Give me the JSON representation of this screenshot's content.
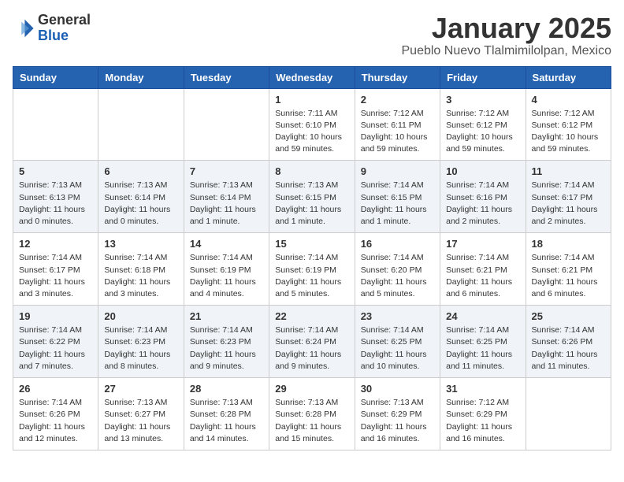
{
  "header": {
    "logo_general": "General",
    "logo_blue": "Blue",
    "month_title": "January 2025",
    "location": "Pueblo Nuevo Tlalmimilolpan, Mexico"
  },
  "days_of_week": [
    "Sunday",
    "Monday",
    "Tuesday",
    "Wednesday",
    "Thursday",
    "Friday",
    "Saturday"
  ],
  "weeks": [
    [
      {
        "day": "",
        "info": ""
      },
      {
        "day": "",
        "info": ""
      },
      {
        "day": "",
        "info": ""
      },
      {
        "day": "1",
        "info": "Sunrise: 7:11 AM\nSunset: 6:10 PM\nDaylight: 10 hours\nand 59 minutes."
      },
      {
        "day": "2",
        "info": "Sunrise: 7:12 AM\nSunset: 6:11 PM\nDaylight: 10 hours\nand 59 minutes."
      },
      {
        "day": "3",
        "info": "Sunrise: 7:12 AM\nSunset: 6:12 PM\nDaylight: 10 hours\nand 59 minutes."
      },
      {
        "day": "4",
        "info": "Sunrise: 7:12 AM\nSunset: 6:12 PM\nDaylight: 10 hours\nand 59 minutes."
      }
    ],
    [
      {
        "day": "5",
        "info": "Sunrise: 7:13 AM\nSunset: 6:13 PM\nDaylight: 11 hours\nand 0 minutes."
      },
      {
        "day": "6",
        "info": "Sunrise: 7:13 AM\nSunset: 6:14 PM\nDaylight: 11 hours\nand 0 minutes."
      },
      {
        "day": "7",
        "info": "Sunrise: 7:13 AM\nSunset: 6:14 PM\nDaylight: 11 hours\nand 1 minute."
      },
      {
        "day": "8",
        "info": "Sunrise: 7:13 AM\nSunset: 6:15 PM\nDaylight: 11 hours\nand 1 minute."
      },
      {
        "day": "9",
        "info": "Sunrise: 7:14 AM\nSunset: 6:15 PM\nDaylight: 11 hours\nand 1 minute."
      },
      {
        "day": "10",
        "info": "Sunrise: 7:14 AM\nSunset: 6:16 PM\nDaylight: 11 hours\nand 2 minutes."
      },
      {
        "day": "11",
        "info": "Sunrise: 7:14 AM\nSunset: 6:17 PM\nDaylight: 11 hours\nand 2 minutes."
      }
    ],
    [
      {
        "day": "12",
        "info": "Sunrise: 7:14 AM\nSunset: 6:17 PM\nDaylight: 11 hours\nand 3 minutes."
      },
      {
        "day": "13",
        "info": "Sunrise: 7:14 AM\nSunset: 6:18 PM\nDaylight: 11 hours\nand 3 minutes."
      },
      {
        "day": "14",
        "info": "Sunrise: 7:14 AM\nSunset: 6:19 PM\nDaylight: 11 hours\nand 4 minutes."
      },
      {
        "day": "15",
        "info": "Sunrise: 7:14 AM\nSunset: 6:19 PM\nDaylight: 11 hours\nand 5 minutes."
      },
      {
        "day": "16",
        "info": "Sunrise: 7:14 AM\nSunset: 6:20 PM\nDaylight: 11 hours\nand 5 minutes."
      },
      {
        "day": "17",
        "info": "Sunrise: 7:14 AM\nSunset: 6:21 PM\nDaylight: 11 hours\nand 6 minutes."
      },
      {
        "day": "18",
        "info": "Sunrise: 7:14 AM\nSunset: 6:21 PM\nDaylight: 11 hours\nand 6 minutes."
      }
    ],
    [
      {
        "day": "19",
        "info": "Sunrise: 7:14 AM\nSunset: 6:22 PM\nDaylight: 11 hours\nand 7 minutes."
      },
      {
        "day": "20",
        "info": "Sunrise: 7:14 AM\nSunset: 6:23 PM\nDaylight: 11 hours\nand 8 minutes."
      },
      {
        "day": "21",
        "info": "Sunrise: 7:14 AM\nSunset: 6:23 PM\nDaylight: 11 hours\nand 9 minutes."
      },
      {
        "day": "22",
        "info": "Sunrise: 7:14 AM\nSunset: 6:24 PM\nDaylight: 11 hours\nand 9 minutes."
      },
      {
        "day": "23",
        "info": "Sunrise: 7:14 AM\nSunset: 6:25 PM\nDaylight: 11 hours\nand 10 minutes."
      },
      {
        "day": "24",
        "info": "Sunrise: 7:14 AM\nSunset: 6:25 PM\nDaylight: 11 hours\nand 11 minutes."
      },
      {
        "day": "25",
        "info": "Sunrise: 7:14 AM\nSunset: 6:26 PM\nDaylight: 11 hours\nand 11 minutes."
      }
    ],
    [
      {
        "day": "26",
        "info": "Sunrise: 7:14 AM\nSunset: 6:26 PM\nDaylight: 11 hours\nand 12 minutes."
      },
      {
        "day": "27",
        "info": "Sunrise: 7:13 AM\nSunset: 6:27 PM\nDaylight: 11 hours\nand 13 minutes."
      },
      {
        "day": "28",
        "info": "Sunrise: 7:13 AM\nSunset: 6:28 PM\nDaylight: 11 hours\nand 14 minutes."
      },
      {
        "day": "29",
        "info": "Sunrise: 7:13 AM\nSunset: 6:28 PM\nDaylight: 11 hours\nand 15 minutes."
      },
      {
        "day": "30",
        "info": "Sunrise: 7:13 AM\nSunset: 6:29 PM\nDaylight: 11 hours\nand 16 minutes."
      },
      {
        "day": "31",
        "info": "Sunrise: 7:12 AM\nSunset: 6:29 PM\nDaylight: 11 hours\nand 16 minutes."
      },
      {
        "day": "",
        "info": ""
      }
    ]
  ]
}
